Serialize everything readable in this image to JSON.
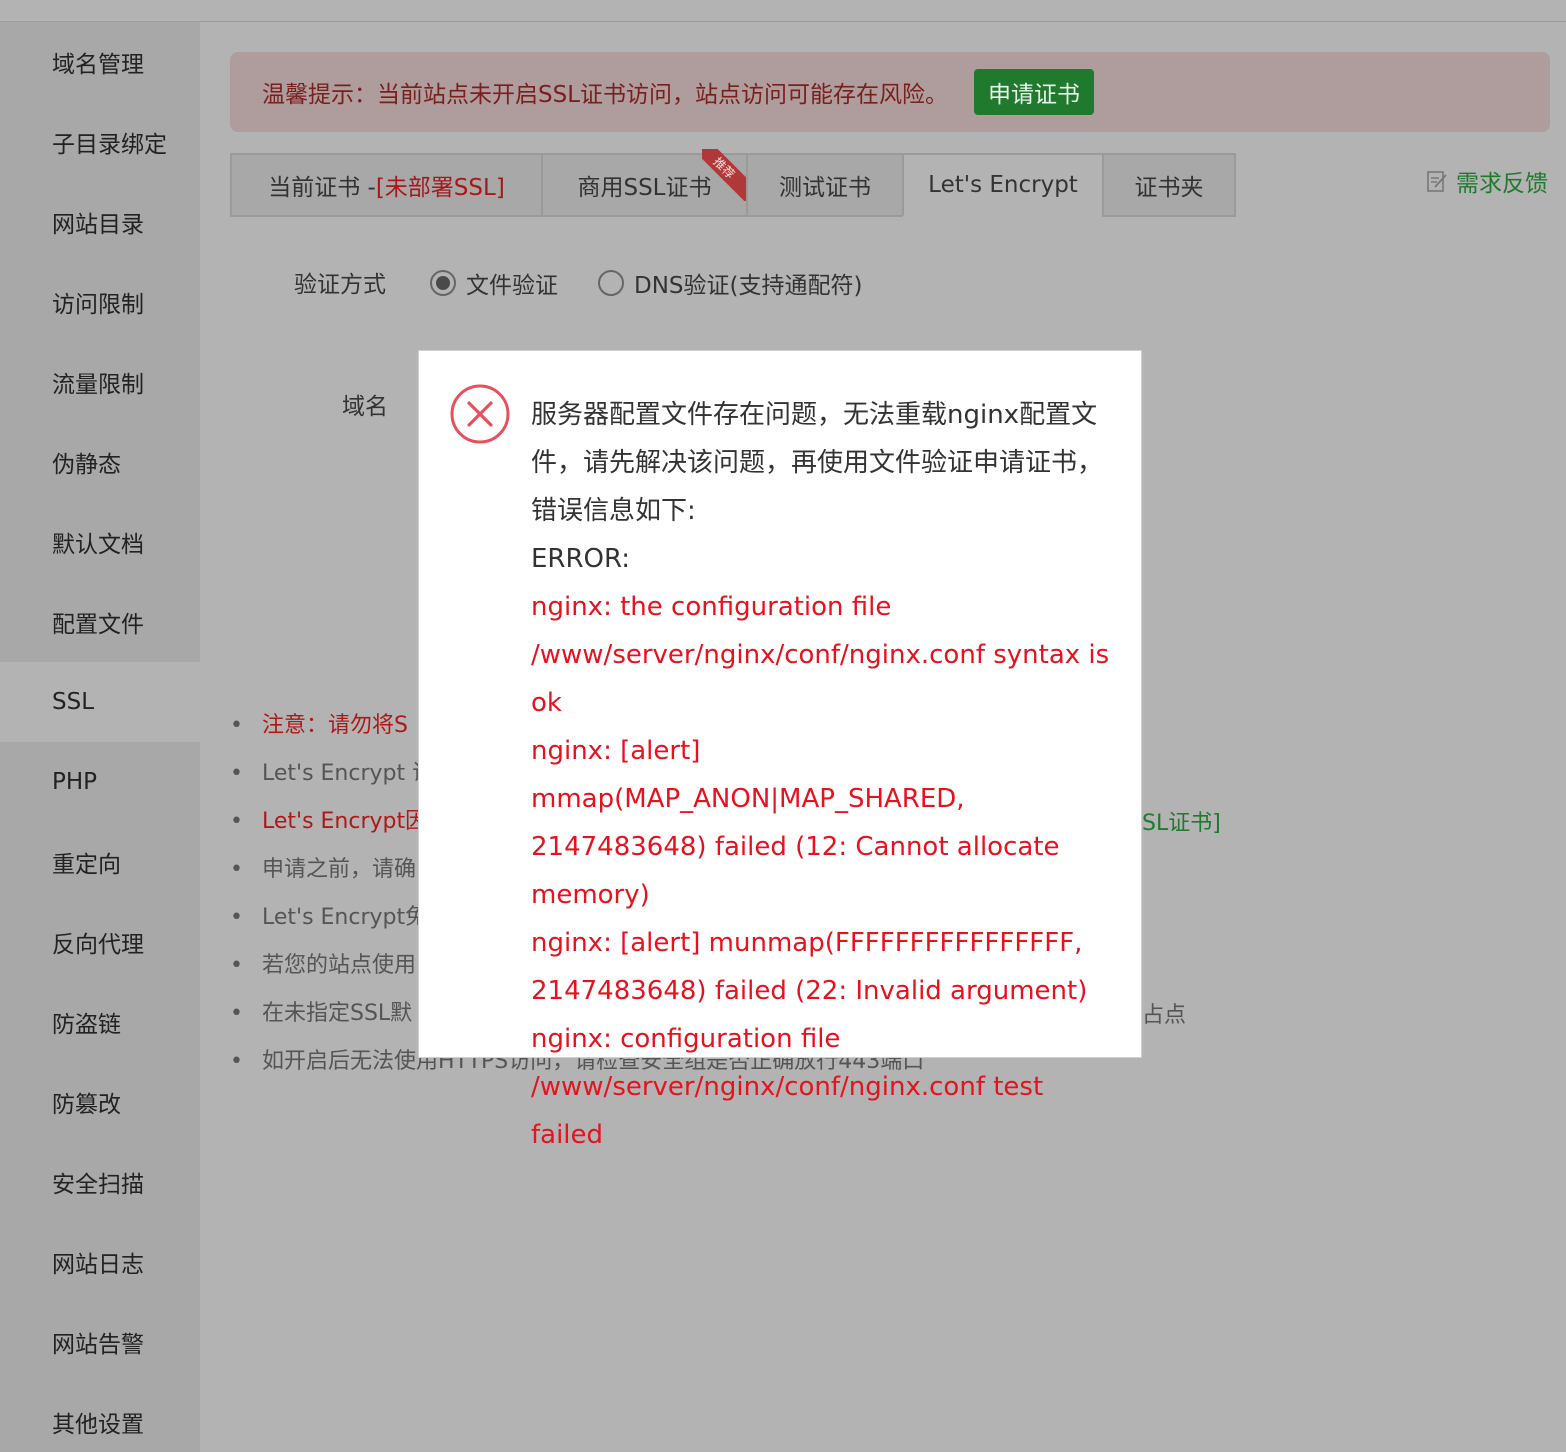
{
  "sidebar": {
    "items": [
      {
        "label": "域名管理",
        "active": false
      },
      {
        "label": "子目录绑定",
        "active": false
      },
      {
        "label": "网站目录",
        "active": false
      },
      {
        "label": "访问限制",
        "active": false
      },
      {
        "label": "流量限制",
        "active": false
      },
      {
        "label": "伪静态",
        "active": false
      },
      {
        "label": "默认文档",
        "active": false
      },
      {
        "label": "配置文件",
        "active": false
      },
      {
        "label": "SSL",
        "active": true
      },
      {
        "label": "PHP",
        "active": false
      },
      {
        "label": "重定向",
        "active": false
      },
      {
        "label": "反向代理",
        "active": false
      },
      {
        "label": "防盗链",
        "active": false
      },
      {
        "label": "防篡改",
        "active": false
      },
      {
        "label": "安全扫描",
        "active": false
      },
      {
        "label": "网站日志",
        "active": false
      },
      {
        "label": "网站告警",
        "active": false
      },
      {
        "label": "其他设置",
        "active": false
      }
    ]
  },
  "alert": {
    "text": "温馨提示：当前站点未开启SSL证书访问，站点访问可能存在风险。",
    "button": "申请证书"
  },
  "tabs": {
    "current_prefix": "当前证书 - ",
    "current_status": "[未部署SSL]",
    "commercial": "商用SSL证书",
    "commercial_badge": "推荐",
    "test": "测试证书",
    "letsencrypt": "Let's Encrypt",
    "folder": "证书夹"
  },
  "feedback": "需求反馈",
  "form": {
    "verify_label": "验证方式",
    "file_verify": "文件验证",
    "dns_verify": "DNS验证(支持通配符)",
    "domain_label": "域名"
  },
  "notes": [
    {
      "text": "注意：请勿将S",
      "red": true
    },
    {
      "text": "Let's Encrypt 证",
      "red": false
    },
    {
      "text": "Let's Encrypt因",
      "red": true
    },
    {
      "text": "申请之前，请确",
      "red": false
    },
    {
      "text": "Let's Encrypt免",
      "red": false
    },
    {
      "text": "若您的站点使用",
      "red": false
    },
    {
      "text": "在未指定SSL默",
      "red": false
    },
    {
      "text": "如开启后无法使用HTTPS访问，请检查安全组是否正确放行443端口",
      "red": false
    }
  ],
  "notes_right": {
    "ssl_link": "SL证书]",
    "site": "占点"
  },
  "modal": {
    "icon": "error-x-icon",
    "message": "服务器配置文件存在问题，无法重载nginx配置文件，请先解决该问题，再使用文件验证申请证书，错误信息如下:",
    "error_header": "ERROR:",
    "error_lines": [
      "nginx: the configuration file /www/server/nginx/conf/nginx.conf syntax is ok",
      "nginx: [alert] mmap(MAP_ANON|MAP_SHARED, 2147483648) failed (12: Cannot allocate memory)",
      "nginx: [alert] munmap(FFFFFFFFFFFFFFFF, 2147483648) failed (22: Invalid argument)",
      "nginx: configuration file /www/server/nginx/conf/nginx.conf test failed"
    ]
  }
}
